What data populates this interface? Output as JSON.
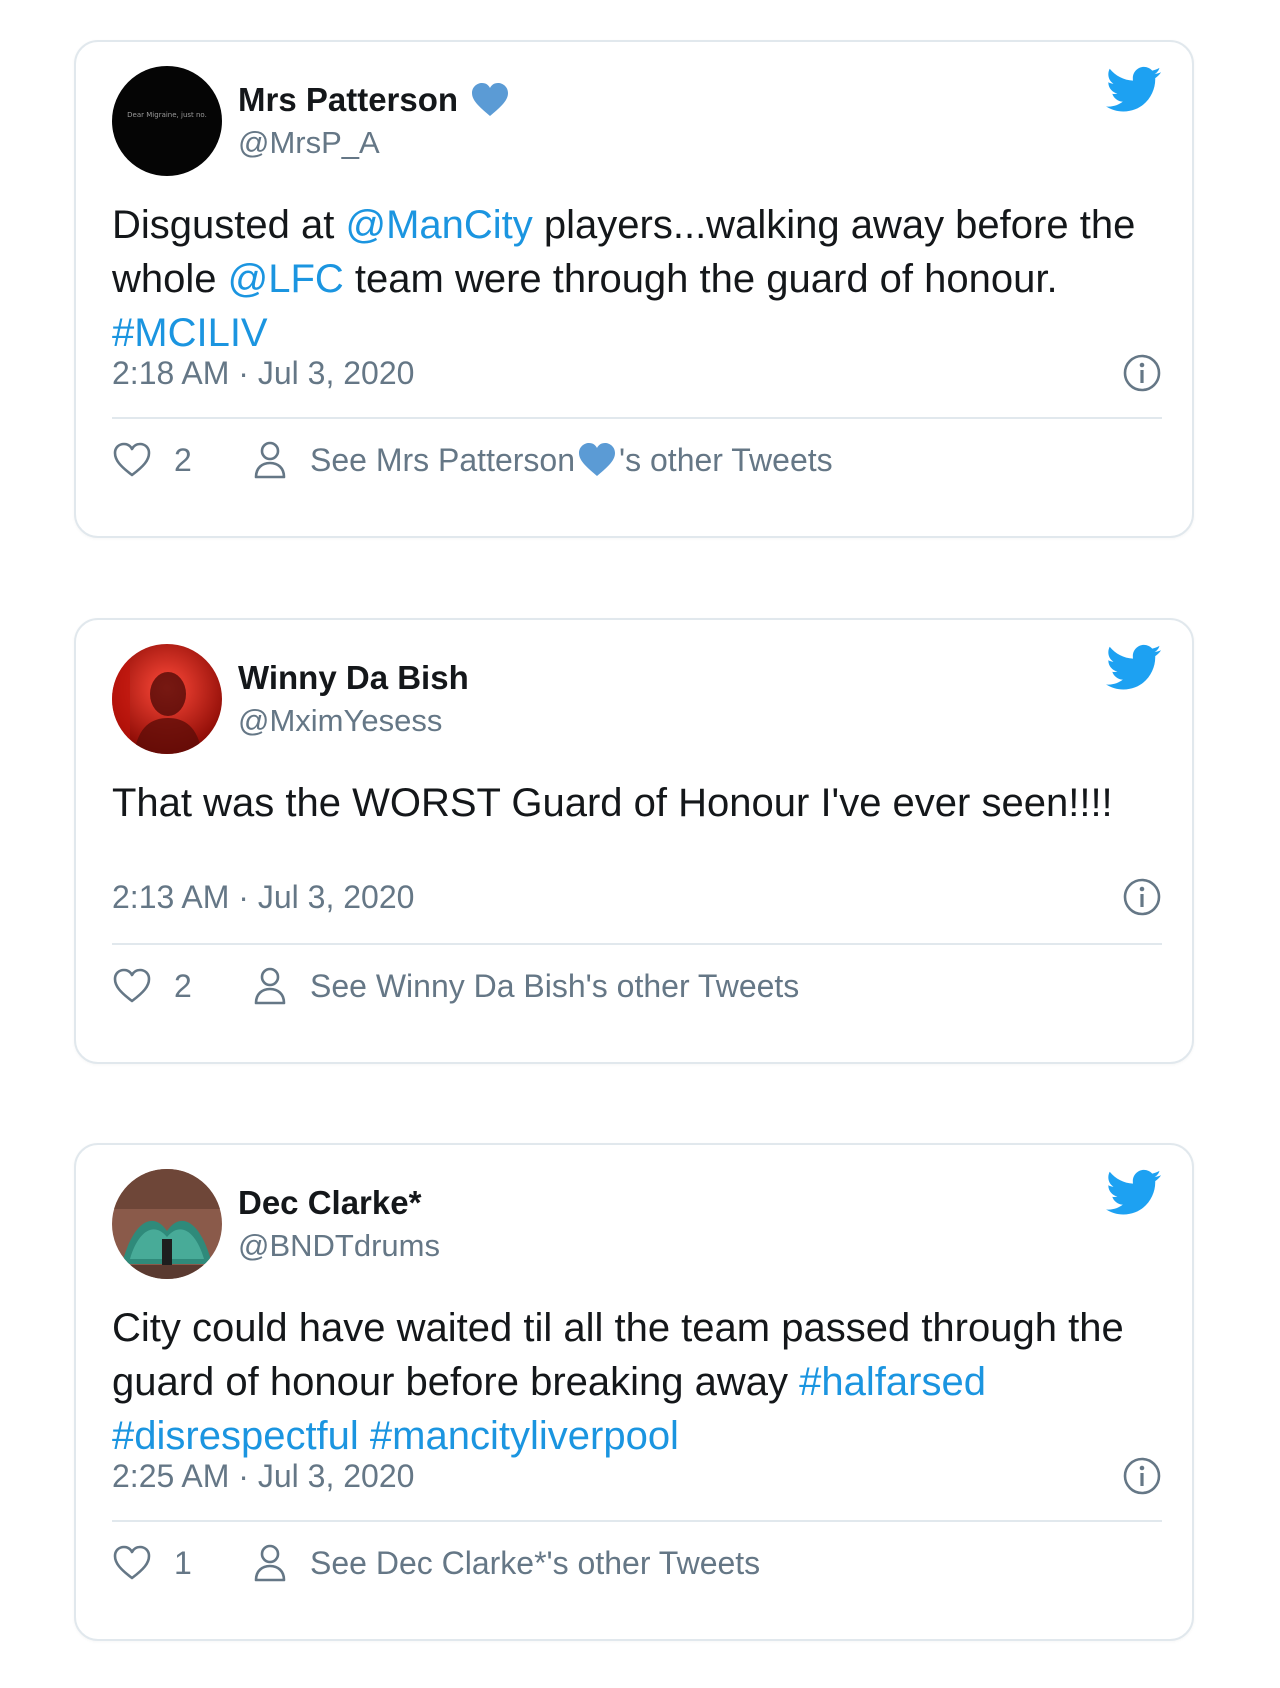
{
  "tweets": [
    {
      "display_name": "Mrs Patterson",
      "handle": "@MrsP_A",
      "text_segments": [
        {
          "text": "Disgusted at "
        },
        {
          "text": "@ManCity",
          "link": true
        },
        {
          "text": " players...walking away before the whole "
        },
        {
          "text": "@LFC",
          "link": true
        },
        {
          "text": " team were through the guard of honour. "
        },
        {
          "text": "#MCILIV",
          "link": true
        }
      ],
      "timestamp": "2:18 AM · Jul 3, 2020",
      "like_count": "2",
      "see_other_prefix": "See Mrs Patterson",
      "see_other_suffix": "'s other Tweets",
      "has_heart": true,
      "avatar_text": "Dear Migraine, just no."
    },
    {
      "display_name": "Winny Da Bish",
      "handle": "@MximYesess",
      "text_segments": [
        {
          "text": "That was the WORST Guard of Honour I've ever seen!!!!"
        }
      ],
      "timestamp": "2:13 AM · Jul 3, 2020",
      "like_count": "2",
      "see_other_prefix": "See Winny Da Bish",
      "see_other_suffix": "'s other Tweets",
      "has_heart": false
    },
    {
      "display_name": "Dec Clarke*",
      "handle": "@BNDTdrums",
      "text_segments": [
        {
          "text": "City could have waited til all the team passed through the guard of honour before breaking away "
        },
        {
          "text": "#halfarsed",
          "link": true
        },
        {
          "text": " "
        },
        {
          "text": "#disrespectful",
          "link": true
        },
        {
          "text": " "
        },
        {
          "text": "#mancityliverpool",
          "link": true
        }
      ],
      "timestamp": "2:25 AM · Jul 3, 2020",
      "like_count": "1",
      "see_other_prefix": "See Dec Clarke*",
      "see_other_suffix": "'s other Tweets",
      "has_heart": false
    }
  ],
  "colors": {
    "twitter_blue": "#1da1f2",
    "link_blue": "#1b95e0",
    "heart_blue": "#5b9bd5",
    "secondary_text": "#657786",
    "border": "#e1e8ed"
  },
  "icons": {
    "brand": "twitter-bird-icon",
    "info": "info-icon",
    "like": "heart-outline-icon",
    "profile": "person-icon",
    "verified": "blue-heart-icon"
  }
}
